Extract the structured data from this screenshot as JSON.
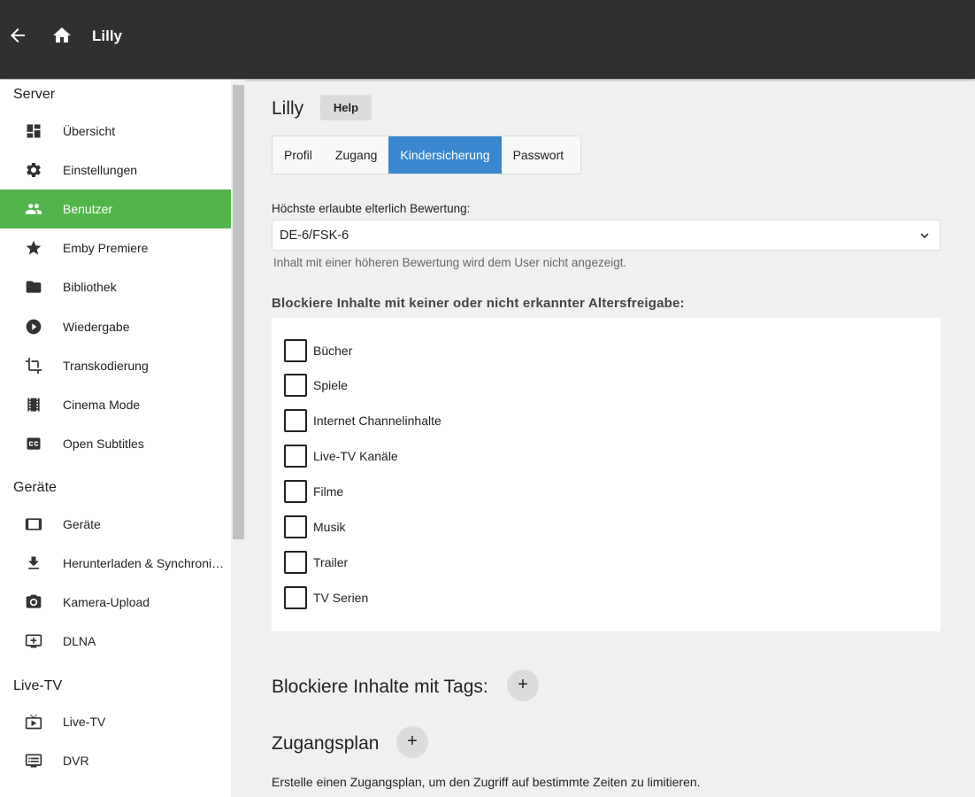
{
  "topbar": {
    "title": "Lilly"
  },
  "sidebar": {
    "sections": [
      {
        "title": "Server",
        "items": [
          {
            "label": "Übersicht",
            "icon": "dashboard-icon"
          },
          {
            "label": "Einstellungen",
            "icon": "gear-icon"
          },
          {
            "label": "Benutzer",
            "icon": "people-icon",
            "active": true
          },
          {
            "label": "Emby Premiere",
            "icon": "star-icon"
          },
          {
            "label": "Bibliothek",
            "icon": "folder-icon"
          },
          {
            "label": "Wiedergabe",
            "icon": "play-circle-icon"
          },
          {
            "label": "Transkodierung",
            "icon": "crop-icon"
          },
          {
            "label": "Cinema Mode",
            "icon": "film-icon"
          },
          {
            "label": "Open Subtitles",
            "icon": "closed-caption-icon"
          }
        ]
      },
      {
        "title": "Geräte",
        "items": [
          {
            "label": "Geräte",
            "icon": "tablet-icon"
          },
          {
            "label": "Herunterladen & Synchronisieren",
            "icon": "download-icon"
          },
          {
            "label": "Kamera-Upload",
            "icon": "camera-icon"
          },
          {
            "label": "DLNA",
            "icon": "dlna-icon"
          }
        ]
      },
      {
        "title": "Live-TV",
        "items": [
          {
            "label": "Live-TV",
            "icon": "live-tv-icon"
          },
          {
            "label": "DVR",
            "icon": "dvr-icon"
          }
        ]
      }
    ]
  },
  "main": {
    "title": "Lilly",
    "help_label": "Help",
    "tabs": [
      {
        "label": "Profil"
      },
      {
        "label": "Zugang"
      },
      {
        "label": "Kindersicherung",
        "active": true
      },
      {
        "label": "Passwort"
      }
    ],
    "rating": {
      "label": "Höchste erlaubte elterlich Bewertung:",
      "value": "DE-6/FSK-6",
      "description": "Inhalt mit einer höheren Bewertung wird dem User nicht angezeigt."
    },
    "block_unrated": {
      "heading": "Blockiere Inhalte mit keiner oder nicht erkannter Altersfreigabe:",
      "items": [
        {
          "label": "Bücher",
          "checked": false
        },
        {
          "label": "Spiele",
          "checked": false
        },
        {
          "label": "Internet Channelinhalte",
          "checked": false
        },
        {
          "label": "Live-TV Kanäle",
          "checked": false
        },
        {
          "label": "Filme",
          "checked": false
        },
        {
          "label": "Musik",
          "checked": false
        },
        {
          "label": "Trailer",
          "checked": false
        },
        {
          "label": "TV Serien",
          "checked": false
        }
      ]
    },
    "tags": {
      "heading": "Blockiere Inhalte mit Tags:",
      "add_label": "+"
    },
    "schedule": {
      "heading": "Zugangsplan",
      "add_label": "+",
      "description": "Erstelle einen Zugangsplan, um den Zugriff auf bestimmte Zeiten zu limitieren."
    }
  },
  "colors": {
    "topbar": "#303030",
    "active_nav": "#52b54b",
    "active_tab": "#3a87cf"
  }
}
